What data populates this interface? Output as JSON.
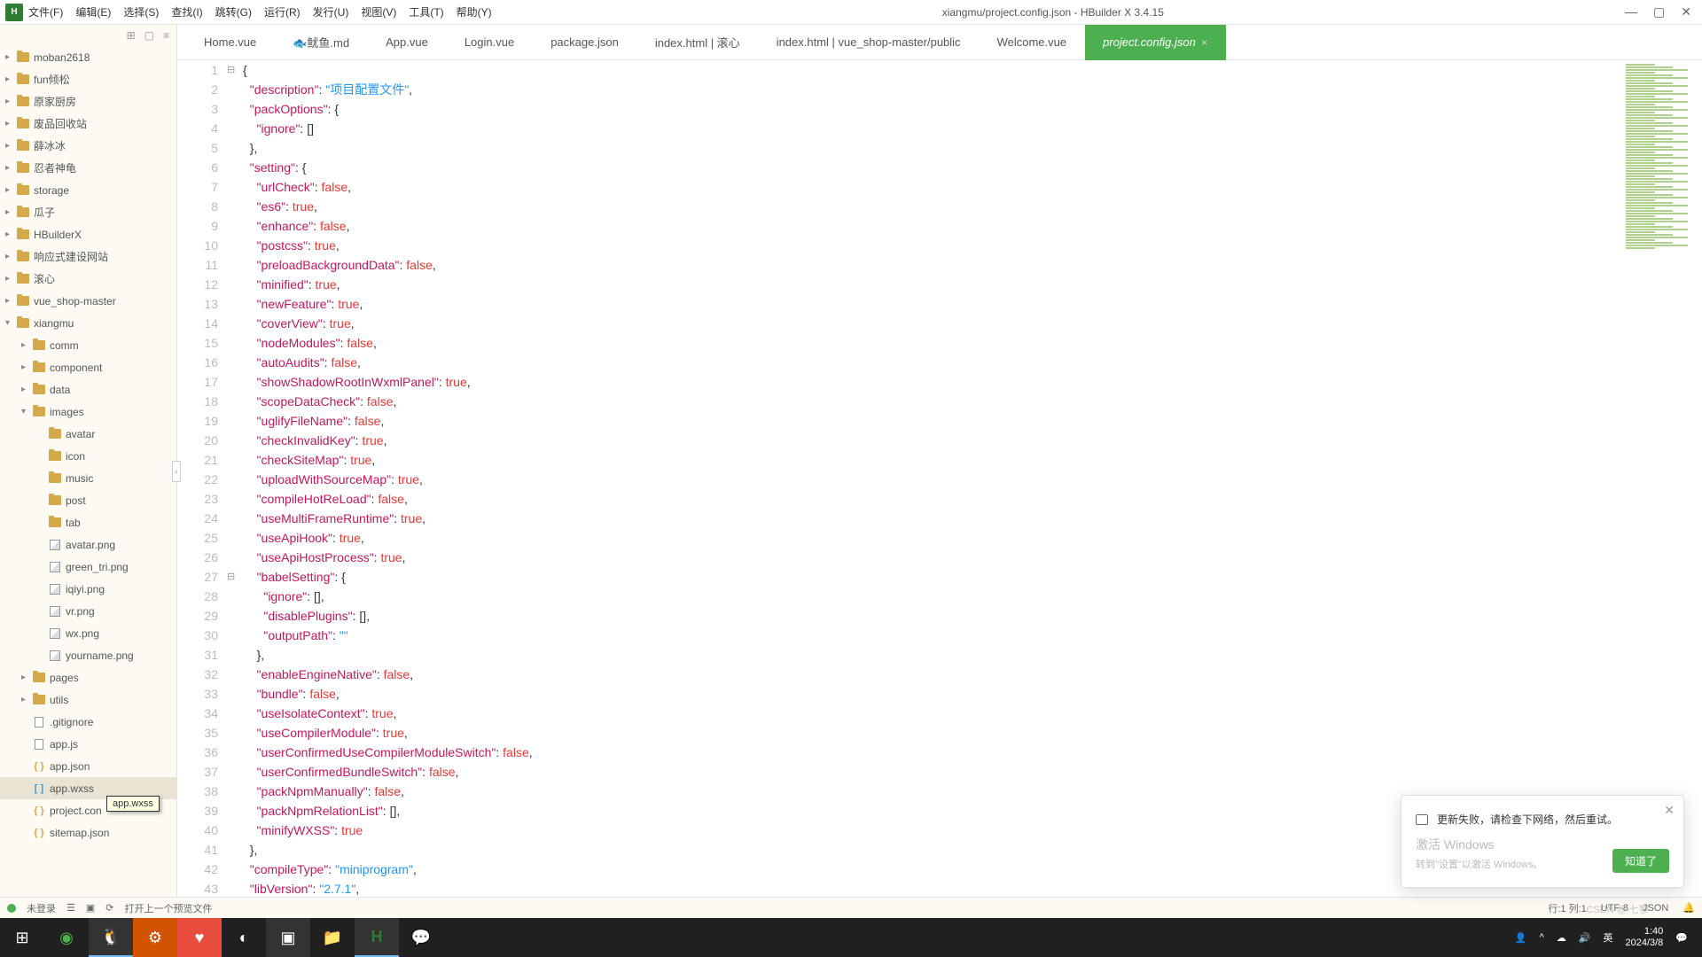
{
  "window": {
    "title": "xiangmu/project.config.json - HBuilder X 3.4.15"
  },
  "menu": [
    "文件(F)",
    "编辑(E)",
    "选择(S)",
    "查找(I)",
    "跳转(G)",
    "运行(R)",
    "发行(U)",
    "视图(V)",
    "工具(T)",
    "帮助(Y)"
  ],
  "sidebar": {
    "tree": [
      {
        "d": 0,
        "arrow": "▸",
        "icon": "folder",
        "label": "moban2618"
      },
      {
        "d": 0,
        "arrow": "▸",
        "icon": "folder",
        "label": "fun倾松"
      },
      {
        "d": 0,
        "arrow": "▸",
        "icon": "folder",
        "label": "原家厨房"
      },
      {
        "d": 0,
        "arrow": "▸",
        "icon": "folder",
        "label": "废品回收站"
      },
      {
        "d": 0,
        "arrow": "▸",
        "icon": "folder",
        "label": "薛冰冰"
      },
      {
        "d": 0,
        "arrow": "▸",
        "icon": "folder",
        "label": "忍者神龟"
      },
      {
        "d": 0,
        "arrow": "▸",
        "icon": "folder",
        "label": "storage"
      },
      {
        "d": 0,
        "arrow": "▸",
        "icon": "folder",
        "label": "瓜子"
      },
      {
        "d": 0,
        "arrow": "▸",
        "icon": "folder",
        "label": "HBuilderX"
      },
      {
        "d": 0,
        "arrow": "▸",
        "icon": "folder",
        "label": "响应式建设网站"
      },
      {
        "d": 0,
        "arrow": "▸",
        "icon": "folder",
        "label": "滚心"
      },
      {
        "d": 0,
        "arrow": "▸",
        "icon": "folder",
        "label": "vue_shop-master"
      },
      {
        "d": 0,
        "arrow": "▾",
        "icon": "folder",
        "label": "xiangmu"
      },
      {
        "d": 1,
        "arrow": "▸",
        "icon": "folder",
        "label": "comm"
      },
      {
        "d": 1,
        "arrow": "▸",
        "icon": "folder",
        "label": "component"
      },
      {
        "d": 1,
        "arrow": "▸",
        "icon": "folder",
        "label": "data"
      },
      {
        "d": 1,
        "arrow": "▾",
        "icon": "folder",
        "label": "images"
      },
      {
        "d": 2,
        "arrow": "",
        "icon": "folder",
        "label": "avatar"
      },
      {
        "d": 2,
        "arrow": "",
        "icon": "folder",
        "label": "icon"
      },
      {
        "d": 2,
        "arrow": "",
        "icon": "folder",
        "label": "music"
      },
      {
        "d": 2,
        "arrow": "",
        "icon": "folder",
        "label": "post"
      },
      {
        "d": 2,
        "arrow": "",
        "icon": "folder",
        "label": "tab"
      },
      {
        "d": 2,
        "arrow": "",
        "icon": "img",
        "label": "avatar.png"
      },
      {
        "d": 2,
        "arrow": "",
        "icon": "img",
        "label": "green_tri.png"
      },
      {
        "d": 2,
        "arrow": "",
        "icon": "img",
        "label": "iqiyi.png"
      },
      {
        "d": 2,
        "arrow": "",
        "icon": "img",
        "label": "vr.png"
      },
      {
        "d": 2,
        "arrow": "",
        "icon": "img",
        "label": "wx.png"
      },
      {
        "d": 2,
        "arrow": "",
        "icon": "img",
        "label": "yourname.png"
      },
      {
        "d": 1,
        "arrow": "▸",
        "icon": "folder",
        "label": "pages"
      },
      {
        "d": 1,
        "arrow": "▸",
        "icon": "folder",
        "label": "utils"
      },
      {
        "d": 1,
        "arrow": "",
        "icon": "file",
        "label": ".gitignore"
      },
      {
        "d": 1,
        "arrow": "",
        "icon": "file",
        "label": "app.js"
      },
      {
        "d": 1,
        "arrow": "",
        "icon": "json",
        "label": "app.json"
      },
      {
        "d": 1,
        "arrow": "",
        "icon": "wxss",
        "label": "app.wxss",
        "selected": true
      },
      {
        "d": 1,
        "arrow": "",
        "icon": "json",
        "label": "project.con"
      },
      {
        "d": 1,
        "arrow": "",
        "icon": "json",
        "label": "sitemap.json"
      }
    ],
    "hover_tooltip": "app.wxss"
  },
  "tabs": [
    {
      "label": "Home.vue"
    },
    {
      "label": "🐟鱿鱼.md"
    },
    {
      "label": "App.vue"
    },
    {
      "label": "Login.vue"
    },
    {
      "label": "package.json"
    },
    {
      "label": "index.html | 滚心"
    },
    {
      "label": "index.html | vue_shop-master/public"
    },
    {
      "label": "Welcome.vue"
    },
    {
      "label": "project.config.json",
      "active": true
    }
  ],
  "code": [
    {
      "n": 1,
      "raw": "{",
      "fold": "⊟"
    },
    {
      "n": 2,
      "k": "\"description\"",
      "s": "\"项目配置文件\"",
      "tail": ","
    },
    {
      "n": 3,
      "k": "\"packOptions\"",
      "after": ": {"
    },
    {
      "n": 4,
      "k": "\"ignore\"",
      "after": ": []",
      "ind": 2
    },
    {
      "n": 5,
      "raw": "},",
      "ind": 1
    },
    {
      "n": 6,
      "k": "\"setting\"",
      "after": ": {"
    },
    {
      "n": 7,
      "k": "\"urlCheck\"",
      "b": "false",
      "tail": ",",
      "ind": 2
    },
    {
      "n": 8,
      "k": "\"es6\"",
      "b": "true",
      "tail": ",",
      "ind": 2
    },
    {
      "n": 9,
      "k": "\"enhance\"",
      "b": "false",
      "tail": ",",
      "ind": 2
    },
    {
      "n": 10,
      "k": "\"postcss\"",
      "b": "true",
      "tail": ",",
      "ind": 2
    },
    {
      "n": 11,
      "k": "\"preloadBackgroundData\"",
      "b": "false",
      "tail": ",",
      "ind": 2
    },
    {
      "n": 12,
      "k": "\"minified\"",
      "b": "true",
      "tail": ",",
      "ind": 2
    },
    {
      "n": 13,
      "k": "\"newFeature\"",
      "b": "true",
      "tail": ",",
      "ind": 2
    },
    {
      "n": 14,
      "k": "\"coverView\"",
      "b": "true",
      "tail": ",",
      "ind": 2
    },
    {
      "n": 15,
      "k": "\"nodeModules\"",
      "b": "false",
      "tail": ",",
      "ind": 2
    },
    {
      "n": 16,
      "k": "\"autoAudits\"",
      "b": "false",
      "tail": ",",
      "ind": 2
    },
    {
      "n": 17,
      "k": "\"showShadowRootInWxmlPanel\"",
      "b": "true",
      "tail": ",",
      "ind": 2
    },
    {
      "n": 18,
      "k": "\"scopeDataCheck\"",
      "b": "false",
      "tail": ",",
      "ind": 2
    },
    {
      "n": 19,
      "k": "\"uglifyFileName\"",
      "b": "false",
      "tail": ",",
      "ind": 2
    },
    {
      "n": 20,
      "k": "\"checkInvalidKey\"",
      "b": "true",
      "tail": ",",
      "ind": 2
    },
    {
      "n": 21,
      "k": "\"checkSiteMap\"",
      "b": "true",
      "tail": ",",
      "ind": 2
    },
    {
      "n": 22,
      "k": "\"uploadWithSourceMap\"",
      "b": "true",
      "tail": ",",
      "ind": 2
    },
    {
      "n": 23,
      "k": "\"compileHotReLoad\"",
      "b": "false",
      "tail": ",",
      "ind": 2
    },
    {
      "n": 24,
      "k": "\"useMultiFrameRuntime\"",
      "b": "true",
      "tail": ",",
      "ind": 2
    },
    {
      "n": 25,
      "k": "\"useApiHook\"",
      "b": "true",
      "tail": ",",
      "ind": 2
    },
    {
      "n": 26,
      "k": "\"useApiHostProcess\"",
      "b": "true",
      "tail": ",",
      "ind": 2
    },
    {
      "n": 27,
      "k": "\"babelSetting\"",
      "after": ": {",
      "ind": 2,
      "fold": "⊟"
    },
    {
      "n": 28,
      "k": "\"ignore\"",
      "after": ": [],",
      "ind": 3
    },
    {
      "n": 29,
      "k": "\"disablePlugins\"",
      "after": ": [],",
      "ind": 3
    },
    {
      "n": 30,
      "k": "\"outputPath\"",
      "s": "\"\"",
      "ind": 3
    },
    {
      "n": 31,
      "raw": "},",
      "ind": 2
    },
    {
      "n": 32,
      "k": "\"enableEngineNative\"",
      "b": "false",
      "tail": ",",
      "ind": 2
    },
    {
      "n": 33,
      "k": "\"bundle\"",
      "b": "false",
      "tail": ",",
      "ind": 2
    },
    {
      "n": 34,
      "k": "\"useIsolateContext\"",
      "b": "true",
      "tail": ",",
      "ind": 2
    },
    {
      "n": 35,
      "k": "\"useCompilerModule\"",
      "b": "true",
      "tail": ",",
      "ind": 2
    },
    {
      "n": 36,
      "k": "\"userConfirmedUseCompilerModuleSwitch\"",
      "b": "false",
      "tail": ",",
      "ind": 2
    },
    {
      "n": 37,
      "k": "\"userConfirmedBundleSwitch\"",
      "b": "false",
      "tail": ",",
      "ind": 2
    },
    {
      "n": 38,
      "k": "\"packNpmManually\"",
      "b": "false",
      "tail": ",",
      "ind": 2
    },
    {
      "n": 39,
      "k": "\"packNpmRelationList\"",
      "after": ": [],",
      "ind": 2
    },
    {
      "n": 40,
      "k": "\"minifyWXSS\"",
      "b": "true",
      "ind": 2
    },
    {
      "n": 41,
      "raw": "},",
      "ind": 1
    },
    {
      "n": 42,
      "k": "\"compileType\"",
      "s": "\"miniprogram\"",
      "tail": ","
    },
    {
      "n": 43,
      "k": "\"libVersion\"",
      "s": "\"2.7.1\"",
      "tail": ","
    }
  ],
  "status": {
    "login": "未登录",
    "preview": "打开上一个预览文件",
    "pos": "行:1  列:1",
    "enc": "UTF-8",
    "lang": "JSON"
  },
  "toast": {
    "title": "更新失败，请检查下网络，然后重试。",
    "line1": "激活 Windows",
    "line2": "转到\"设置\"以激活 Windows。",
    "btn": "知道了"
  },
  "taskbar": {
    "time": "1:40",
    "date": "2024/3/8",
    "ime": "英"
  },
  "watermark": "CSDN @ 七寥"
}
